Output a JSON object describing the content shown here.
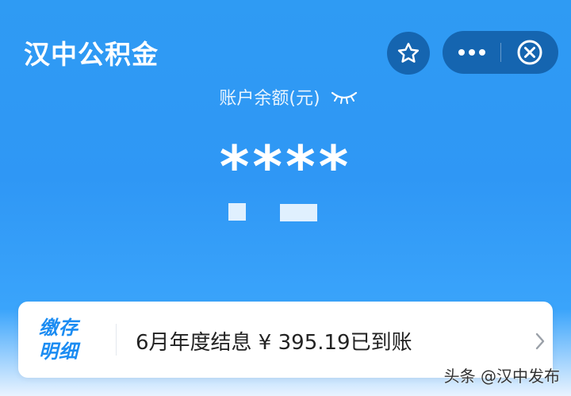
{
  "header": {
    "app_title": "汉中公积金"
  },
  "balance": {
    "label": "账户余额(元)",
    "value": "****"
  },
  "notice": {
    "tag_line1": "缴存",
    "tag_line2": "明细",
    "text": "6月年度结息 ¥ 395.19已到账"
  },
  "watermark": "头条 @汉中发布",
  "icons": {
    "favorite": "star-icon",
    "more": "more-dots-icon",
    "close": "close-circle-icon",
    "visibility": "eye-closed-icon",
    "arrow": "chevron-right-icon"
  },
  "colors": {
    "background_top": "#2f9bf3",
    "accent": "#1b8cf2",
    "capsule": "#1e5d9f"
  }
}
